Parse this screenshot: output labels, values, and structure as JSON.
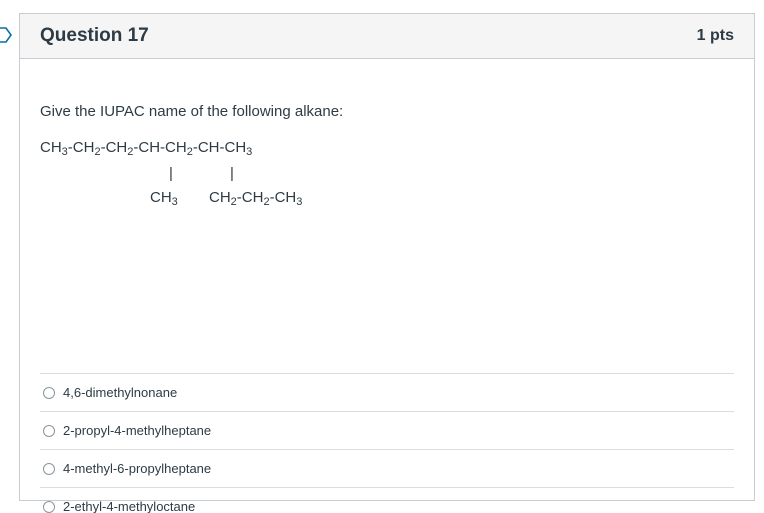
{
  "question": {
    "title": "Question 17",
    "points": "1 pts",
    "prompt": "Give the IUPAC name of the following alkane:"
  },
  "formula": {
    "main_parts": [
      "CH",
      "3",
      "-CH",
      "2",
      "-CH",
      "2",
      "-CH-CH",
      "2",
      "-CH-CH",
      "3"
    ],
    "bar": "|",
    "branch_left_parts": [
      "CH",
      "3"
    ],
    "branch_right_parts": [
      "CH",
      "2",
      "-CH",
      "2",
      "-CH",
      "3"
    ]
  },
  "answers": [
    {
      "label": "4,6-dimethylnonane",
      "selected": false
    },
    {
      "label": "2-propyl-4-methylheptane",
      "selected": false
    },
    {
      "label": "4-methyl-6-propylheptane",
      "selected": false
    },
    {
      "label": "2-ethyl-4-methyloctane",
      "selected": false
    }
  ],
  "colors": {
    "text": "#2d3b45",
    "header_bg": "#f5f5f5",
    "border": "#c7cdd1",
    "flag": "#0770a3"
  }
}
